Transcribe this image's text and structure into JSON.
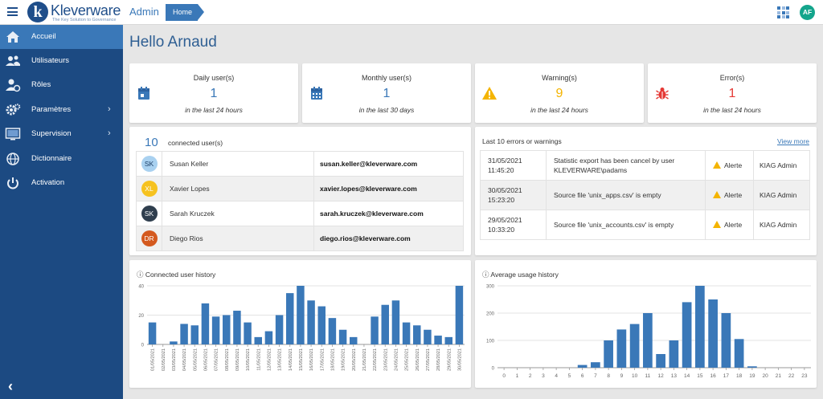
{
  "header": {
    "brand": "Kleverware",
    "tagline": "The Key Solution to Governance",
    "app_title": "Admin",
    "breadcrumb": "Home",
    "user_initials": "AF",
    "user_avatar_color": "#14a58c"
  },
  "sidebar": {
    "items": [
      {
        "label": "Accueil",
        "icon": "home-icon",
        "active": true
      },
      {
        "label": "Utilisateurs",
        "icon": "users-icon"
      },
      {
        "label": "Rôles",
        "icon": "user-role-icon"
      },
      {
        "label": "Paramètres",
        "icon": "gears-icon",
        "chevron": "›"
      },
      {
        "label": "Supervision",
        "icon": "monitor-icon",
        "chevron": "›"
      },
      {
        "label": "Dictionnaire",
        "icon": "globe-icon"
      },
      {
        "label": "Activation",
        "icon": "power-icon"
      }
    ],
    "collapse_glyph": "‹"
  },
  "page": {
    "greeting": "Hello Arnaud"
  },
  "stats": [
    {
      "label": "Daily user(s)",
      "value": "1",
      "sub": "in the last 24 hours",
      "icon": "calendar-icon",
      "color": "#3a78b8"
    },
    {
      "label": "Monthly user(s)",
      "value": "1",
      "sub": "in the last 30 days",
      "icon": "calendar-icon",
      "color": "#3a78b8"
    },
    {
      "label": "Warning(s)",
      "value": "9",
      "sub": "in the last 24 hours",
      "icon": "warning-icon",
      "color": "#f4b400"
    },
    {
      "label": "Error(s)",
      "value": "1",
      "sub": "in the last 24 hours",
      "icon": "bug-icon",
      "color": "#e53935"
    }
  ],
  "connected_users": {
    "count": "10",
    "label": "connected user(s)",
    "rows": [
      {
        "initials": "SK",
        "name": "Susan Keller",
        "email": "susan.keller@kleverware.com",
        "color": "#a9d1f0"
      },
      {
        "initials": "XL",
        "name": "Xavier Lopes",
        "email": "xavier.lopes@kleverware.com",
        "color": "#f6c21f"
      },
      {
        "initials": "SK",
        "name": "Sarah Kruczek",
        "email": "sarah.kruczek@kleverware.com",
        "color": "#2f3e4e"
      },
      {
        "initials": "DR",
        "name": "Diego Rios",
        "email": "diego.rios@kleverware.com",
        "color": "#d4591e"
      }
    ]
  },
  "errors": {
    "title": "Last 10 errors or warnings",
    "view_more": "View more",
    "rows": [
      {
        "date": "31/05/2021",
        "time": "11:45:20",
        "message": "Statistic export has been cancel by user KLEVERWARE\\padams",
        "level": "Alerte",
        "source": "KIAG Admin"
      },
      {
        "date": "30/05/2021",
        "time": "15:23:20",
        "message": "Source file 'unix_apps.csv' is empty",
        "level": "Alerte",
        "source": "KIAG Admin"
      },
      {
        "date": "29/05/2021",
        "time": "10:33:20",
        "message": "Source file 'unix_accounts.csv' is empty",
        "level": "Alerte",
        "source": "KIAG Admin"
      }
    ]
  },
  "charts": {
    "connected_title": "Connected user history",
    "usage_title": "Average usage history"
  },
  "chart_data": [
    {
      "type": "bar",
      "title": "Connected user history",
      "ylim": [
        0,
        40
      ],
      "yticks": [
        0,
        20,
        40
      ],
      "grid": true,
      "bar_color": "#3a78b8",
      "categories": [
        "01/05/2021",
        "02/05/2021",
        "03/05/2021",
        "04/05/2021",
        "05/05/2021",
        "06/05/2021",
        "07/05/2021",
        "08/05/2021",
        "09/05/2021",
        "10/05/2021",
        "11/05/2021",
        "12/05/2021",
        "13/05/2021",
        "14/05/2021",
        "15/05/2021",
        "16/05/2021",
        "17/05/2021",
        "18/05/2021",
        "19/05/2021",
        "20/05/2021",
        "21/05/2021",
        "22/05/2021",
        "23/05/2021",
        "24/05/2021",
        "25/05/2021",
        "26/05/2021",
        "27/05/2021",
        "28/05/2021",
        "29/05/2021",
        "30/05/2021"
      ],
      "values": [
        15,
        0,
        2,
        14,
        13,
        28,
        19,
        20,
        23,
        15,
        5,
        9,
        20,
        35,
        40,
        30,
        26,
        18,
        10,
        5,
        0,
        19,
        27,
        30,
        15,
        13,
        10,
        6,
        5,
        40
      ]
    },
    {
      "type": "bar",
      "title": "Average usage history",
      "ylim": [
        0,
        300
      ],
      "yticks": [
        0,
        100,
        200,
        300
      ],
      "grid": true,
      "bar_color": "#3a78b8",
      "categories": [
        "0",
        "1",
        "2",
        "3",
        "4",
        "5",
        "6",
        "7",
        "8",
        "9",
        "10",
        "11",
        "12",
        "13",
        "14",
        "15",
        "16",
        "17",
        "18",
        "19",
        "20",
        "21",
        "22",
        "23"
      ],
      "values": [
        0,
        0,
        0,
        0,
        0,
        0,
        10,
        20,
        100,
        140,
        160,
        200,
        50,
        100,
        240,
        300,
        250,
        200,
        105,
        5,
        0,
        0,
        0,
        0
      ]
    }
  ]
}
